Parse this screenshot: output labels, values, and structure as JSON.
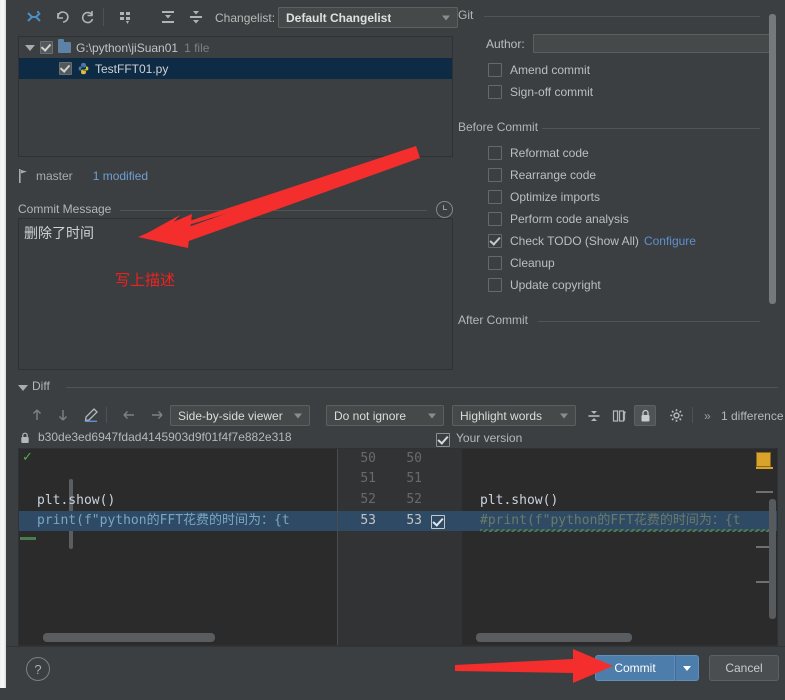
{
  "toolbar": {
    "icons": [
      {
        "name": "show-diff-icon",
        "glyph": "diff"
      },
      {
        "name": "revert-icon",
        "glyph": "undo"
      },
      {
        "name": "refresh-icon",
        "glyph": "refresh"
      },
      {
        "name": "group-by-icon",
        "glyph": "group"
      },
      {
        "name": "expand-all-icon",
        "glyph": "expand"
      },
      {
        "name": "collapse-all-icon",
        "glyph": "collapse"
      }
    ],
    "changelist_label": "Changelist:",
    "changelist_value": "Default Changelist"
  },
  "file_tree": {
    "root": {
      "path": "G:\\python\\jiSuan01",
      "count": "1 file",
      "checked": true,
      "expanded": true
    },
    "children": [
      {
        "name": "TestFFT01.py",
        "checked": true,
        "selected": true
      }
    ]
  },
  "branch_bar": {
    "branch": "master",
    "modified": "1 modified"
  },
  "commit_message": {
    "title": "Commit Message",
    "value": "删除了时间",
    "annotation": "写上描述",
    "annotation_color": "#f02020"
  },
  "git_panel": {
    "section_git": "Git",
    "author_label": "Author:",
    "author_value": "",
    "options_git": [
      {
        "label": "Amend commit",
        "checked": false
      },
      {
        "label": "Sign-off commit",
        "checked": false
      }
    ],
    "section_before": "Before Commit",
    "options_before": [
      {
        "label": "Reformat code",
        "checked": false
      },
      {
        "label": "Rearrange code",
        "checked": false
      },
      {
        "label": "Optimize imports",
        "checked": false
      },
      {
        "label": "Perform code analysis",
        "checked": false
      },
      {
        "label": "Check TODO (Show All)",
        "checked": true,
        "link": "Configure"
      },
      {
        "label": "Cleanup",
        "checked": false
      },
      {
        "label": "Update copyright",
        "checked": false
      }
    ],
    "section_after": "After Commit"
  },
  "diff": {
    "title": "Diff",
    "viewer_mode": "Side-by-side viewer",
    "ignore_mode": "Do not ignore",
    "highlight_mode": "Highlight words",
    "difference_count": "1 difference",
    "chevron": "»",
    "revision_hash": "b30de3ed6947fdad4145903d9f01f4f7e882e318",
    "your_version_label": "Your version",
    "your_version_checked": true,
    "icons": [
      {
        "name": "previous-difference-icon"
      },
      {
        "name": "next-difference-icon"
      },
      {
        "name": "edit-icon"
      },
      {
        "name": "accept-left-icon"
      },
      {
        "name": "accept-right-icon"
      },
      {
        "name": "collapse-unchanged-icon"
      },
      {
        "name": "synchronize-scroll-icon"
      },
      {
        "name": "lock-read-only-icon"
      },
      {
        "name": "settings-gear-icon"
      }
    ],
    "left_lines": [
      {
        "num": "50",
        "text": ""
      },
      {
        "num": "51",
        "text": ""
      },
      {
        "num": "52",
        "text": "plt.show()"
      },
      {
        "num": "53",
        "text": "print(f\"python的FFT花费的时间为：{t",
        "highlighted": true
      }
    ],
    "right_lines": [
      {
        "num": "50",
        "text": ""
      },
      {
        "num": "51",
        "text": ""
      },
      {
        "num": "52",
        "text": "plt.show()"
      },
      {
        "num": "53",
        "text": "#print(f\"python的FFT花费的时间为：{t",
        "highlighted": true,
        "checked": true
      }
    ]
  },
  "footer": {
    "help_label": "?",
    "commit_label": "Commit",
    "cancel_label": "Cancel"
  },
  "annotations": {
    "arrow_color": "#f42d2d",
    "arrow_top": "arrow-to-commit-message",
    "arrow_bottom": "arrow-to-commit-button"
  }
}
